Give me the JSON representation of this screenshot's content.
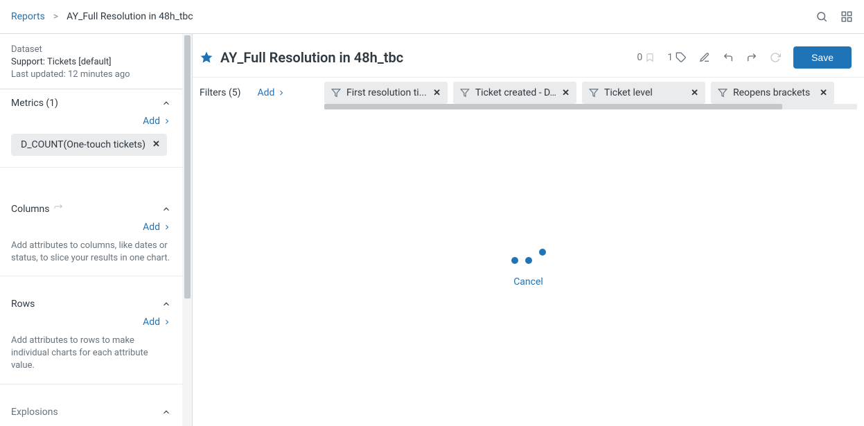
{
  "breadcrumb": {
    "root": "Reports",
    "current": "AY_Full Resolution in 48h_tbc"
  },
  "dataset": {
    "label": "Dataset",
    "name": "Support: Tickets [default]",
    "updated": "Last updated: 12 minutes ago"
  },
  "sidebar": {
    "metrics": {
      "title": "Metrics (1)",
      "add": "Add",
      "chip": "D_COUNT(One-touch tickets)"
    },
    "columns": {
      "title": "Columns",
      "add": "Add",
      "help": "Add attributes to columns, like dates or status, to slice your results in one chart."
    },
    "rows": {
      "title": "Rows",
      "add": "Add",
      "help": "Add attributes to rows to make individual charts for each attribute value."
    },
    "explosions": {
      "title": "Explosions"
    }
  },
  "header": {
    "title": "AY_Full Resolution in 48h_tbc",
    "count0": "0",
    "count1": "1",
    "save": "Save"
  },
  "filters": {
    "label": "Filters (5)",
    "add": "Add",
    "items": [
      "First resolution ti...",
      "Ticket created - D...",
      "Ticket level",
      "Reopens brackets"
    ]
  },
  "canvas": {
    "cancel": "Cancel"
  }
}
